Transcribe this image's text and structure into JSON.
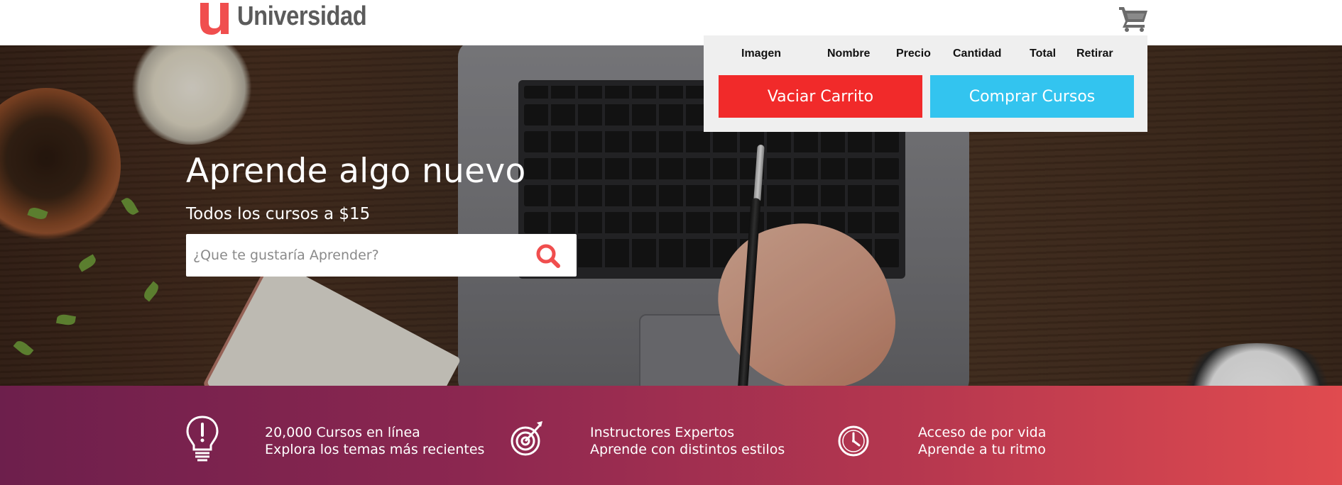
{
  "header": {
    "logo_letter": "u",
    "logo_text": "Universidad",
    "cart_icon": "shopping-cart-icon"
  },
  "hero": {
    "title": "Aprende algo nuevo",
    "subtitle": "Todos los cursos a $15",
    "search": {
      "placeholder": "¿Que te gustaría Aprender?",
      "value": "",
      "icon": "search-icon"
    }
  },
  "cart": {
    "columns": [
      "Imagen",
      "Nombre",
      "Precio",
      "Cantidad",
      "Total",
      "Retirar"
    ],
    "empty_label": "Vaciar Carrito",
    "buy_label": "Comprar Cursos"
  },
  "features": [
    {
      "icon": "lightbulb-icon",
      "line1": "20,000 Cursos en línea",
      "line2": "Explora los temas más recientes"
    },
    {
      "icon": "target-icon",
      "line1": "Instructores Expertos",
      "line2": "Aprende con distintos estilos"
    },
    {
      "icon": "clock-icon",
      "line1": "Acceso de por vida",
      "line2": "Aprende a tu ritmo"
    }
  ],
  "colors": {
    "brand_red": "#f04e4e",
    "empty_button": "#f12a2a",
    "buy_button": "#33c4ef",
    "feature_gradient_start": "#6d1f4c",
    "feature_gradient_end": "#e04b4f"
  }
}
